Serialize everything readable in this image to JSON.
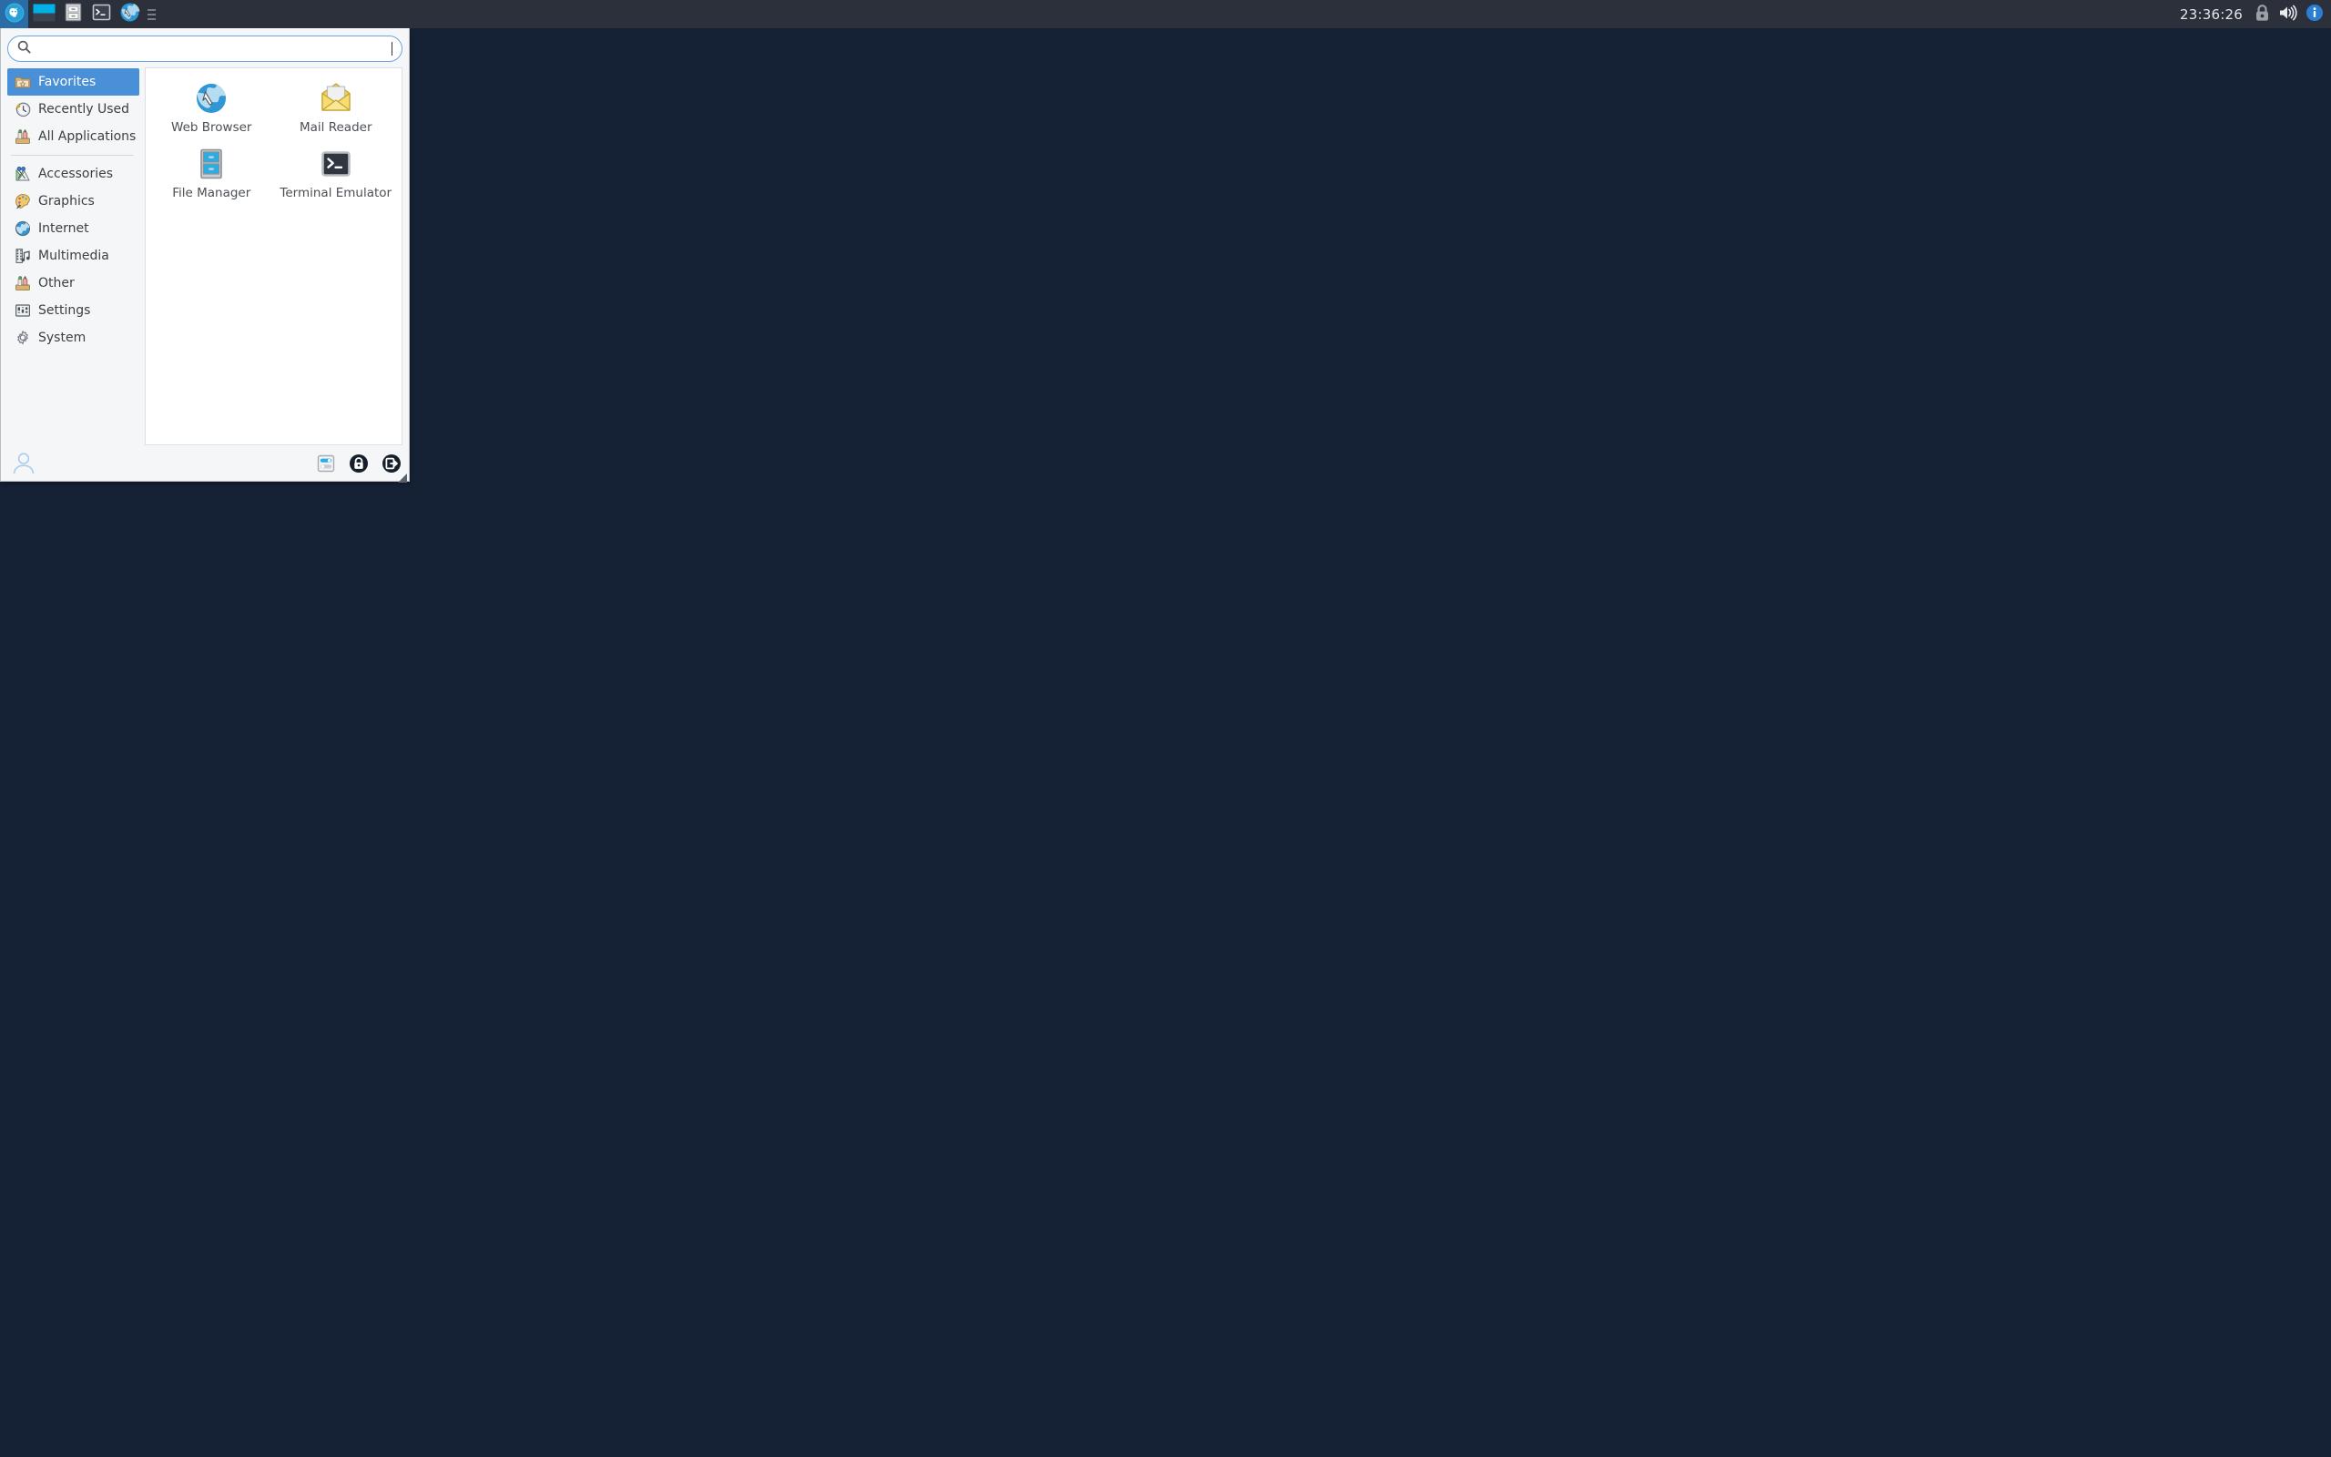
{
  "panel": {
    "launchers": [
      {
        "name": "applications-menu-button",
        "icon": "xfce-mouse-icon",
        "active": true
      },
      {
        "name": "workspace-switcher",
        "icon": "pager-icon",
        "active": false
      },
      {
        "name": "file-manager-launcher",
        "icon": "file-manager-icon",
        "active": false
      },
      {
        "name": "terminal-launcher",
        "icon": "terminal-icon",
        "active": false
      },
      {
        "name": "web-browser-launcher",
        "icon": "web-browser-icon",
        "active": false
      }
    ],
    "clock": "23:36:26",
    "tray": [
      {
        "name": "screensaver-lock-icon",
        "icon": "lock-icon"
      },
      {
        "name": "volume-icon",
        "icon": "speaker-icon"
      },
      {
        "name": "notification-info-icon",
        "icon": "info-icon"
      }
    ]
  },
  "menu": {
    "search": {
      "value": "",
      "placeholder": ""
    },
    "categories": [
      {
        "label": "Favorites",
        "icon": "folder-star-icon",
        "selected": true
      },
      {
        "label": "Recently Used",
        "icon": "clock-history-icon",
        "selected": false
      },
      {
        "label": "All Applications",
        "icon": "applications-icon",
        "selected": false
      },
      {
        "label": "Accessories",
        "icon": "accessories-icon",
        "selected": false
      },
      {
        "label": "Graphics",
        "icon": "palette-icon",
        "selected": false
      },
      {
        "label": "Internet",
        "icon": "globe-icon",
        "selected": false
      },
      {
        "label": "Multimedia",
        "icon": "film-music-icon",
        "selected": false
      },
      {
        "label": "Other",
        "icon": "applications-icon",
        "selected": false
      },
      {
        "label": "Settings",
        "icon": "sliders-icon",
        "selected": false
      },
      {
        "label": "System",
        "icon": "gear-icon",
        "selected": false
      }
    ],
    "separator_after_index": 2,
    "apps": [
      {
        "label": "Web Browser",
        "icon": "web-browser-icon"
      },
      {
        "label": "Mail Reader",
        "icon": "mail-icon"
      },
      {
        "label": "File Manager",
        "icon": "file-manager-icon"
      },
      {
        "label": "Terminal Emulator",
        "icon": "terminal-icon"
      }
    ],
    "footer": {
      "user_icon": "user-avatar-icon",
      "buttons": [
        {
          "name": "settings-button",
          "icon": "sliders-toggle-icon"
        },
        {
          "name": "lock-screen-button",
          "icon": "padlock-icon"
        },
        {
          "name": "log-out-button",
          "icon": "logout-icon"
        }
      ]
    }
  },
  "colors": {
    "desktop_bg": "#152235",
    "panel_bg": "#2b303b",
    "accent": "#4a90d9",
    "panel_active": "#2a6ca8",
    "menu_bg": "#f5f6f7"
  }
}
